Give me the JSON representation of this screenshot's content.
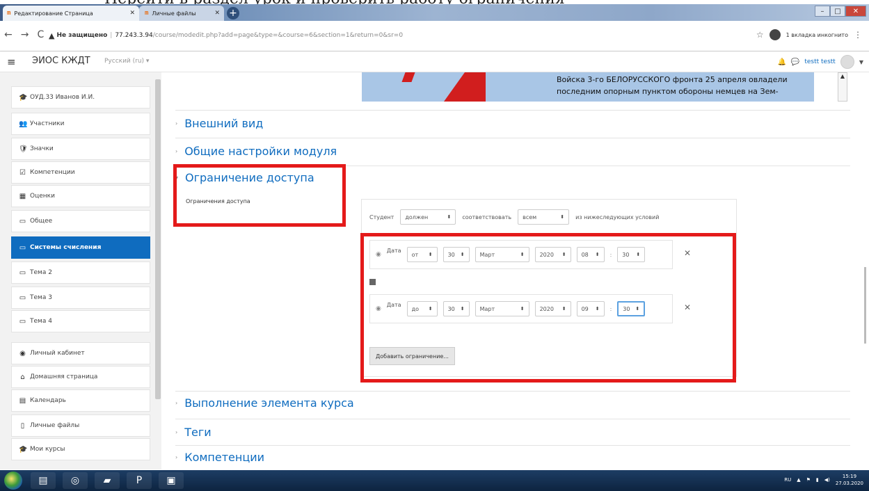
{
  "doc_strip_text": "Перейти в раздел урок и проверить работу ограничения",
  "browser": {
    "tabs": [
      {
        "label": "Редактирование Страница",
        "favicon": "m",
        "active": true
      },
      {
        "label": "Личные файлы",
        "favicon": "m",
        "active": false
      }
    ],
    "new_tab": "+",
    "security_label": "Не защищено",
    "url_host": "77.243.3.94",
    "url_path": "/course/modedit.php?add=page&type=&course=6&section=1&return=0&sr=0",
    "incognito_label": "1 вкладка инкогнито"
  },
  "header": {
    "site_name": "ЭИОС КЖДТ",
    "language": "Русский (ru) ▾",
    "user_name": "testt testt"
  },
  "sidebar": {
    "items": [
      {
        "label": "ОУД.33 Иванов И.И.",
        "icon": "graduation-cap-icon",
        "glyph": "🎓"
      },
      {
        "label": "Участники",
        "icon": "users-icon",
        "glyph": "👥"
      },
      {
        "label": "Значки",
        "icon": "badge-icon",
        "glyph": "🛡"
      },
      {
        "label": "Компетенции",
        "icon": "check-square-icon",
        "glyph": "☑"
      },
      {
        "label": "Оценки",
        "icon": "table-icon",
        "glyph": "▦"
      },
      {
        "label": "Общее",
        "icon": "folder-icon",
        "glyph": "▭"
      },
      {
        "label": "Системы счисления",
        "icon": "folder-icon",
        "glyph": "▭",
        "active": true
      },
      {
        "label": "Тема 2",
        "icon": "folder-icon",
        "glyph": "▭"
      },
      {
        "label": "Тема 3",
        "icon": "folder-icon",
        "glyph": "▭"
      },
      {
        "label": "Тема 4",
        "icon": "folder-icon",
        "glyph": "▭"
      },
      {
        "label": "Личный кабинет",
        "icon": "dashboard-icon",
        "glyph": "◉"
      },
      {
        "label": "Домашняя страница",
        "icon": "home-icon",
        "glyph": "⌂"
      },
      {
        "label": "Календарь",
        "icon": "calendar-icon",
        "glyph": "▤"
      },
      {
        "label": "Личные файлы",
        "icon": "file-icon",
        "glyph": "▯"
      },
      {
        "label": "Мои курсы",
        "icon": "graduation-cap-icon",
        "glyph": "🎓"
      }
    ]
  },
  "main": {
    "image_text": "Войска 3-го БЕЛОРУССКОГО фронта 25 апреля овладели последним опорным пунктом обороны немцев на Зем-",
    "sections": {
      "appearance": "Внешний вид",
      "common_settings": "Общие настройки модуля",
      "access_restriction": "Ограничение доступа",
      "access_restriction_desc": "Ограничения доступа",
      "completion": "Выполнение элемента курса",
      "tags": "Теги",
      "competencies": "Компетенции"
    },
    "restrictions": {
      "student_label": "Студент",
      "must_value": "должен",
      "match_label": "соответствовать",
      "all_value": "всем",
      "conditions_label": "из нижеследующих условий",
      "conditions": [
        {
          "label": "Дата",
          "direction": "от",
          "day": "30",
          "month": "Март",
          "year": "2020",
          "hour": "08",
          "minute": "30"
        },
        {
          "label": "Дата",
          "direction": "до",
          "day": "30",
          "month": "Март",
          "year": "2020",
          "hour": "09",
          "minute": "30"
        }
      ],
      "time_sep": ":",
      "add_button": "Добавить ограничение..."
    }
  },
  "taskbar": {
    "lang": "RU",
    "time": "15:19",
    "date": "27.03.2020"
  },
  "colors": {
    "accent": "#0f6cbf",
    "annotation_red": "#e41a1a"
  }
}
